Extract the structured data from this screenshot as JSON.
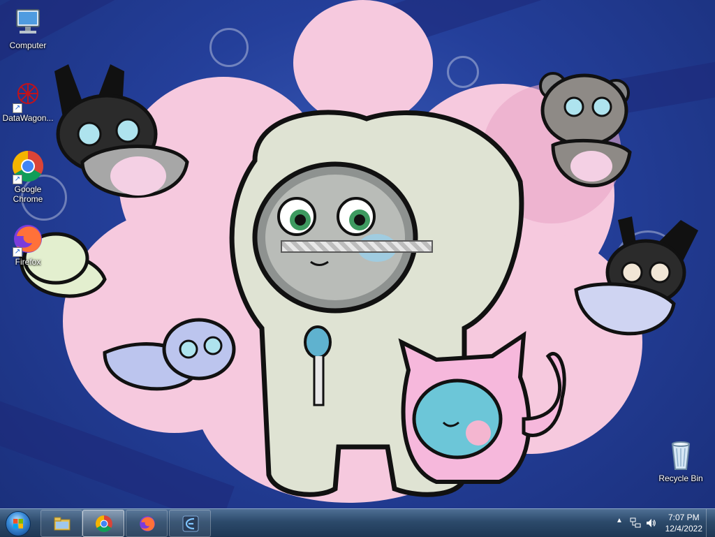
{
  "desktop": {
    "icons": [
      {
        "label": "Computer"
      },
      {
        "label": "DataWagon..."
      },
      {
        "label": "Google Chrome"
      },
      {
        "label": "Firefox"
      },
      {
        "label": "Recycle Bin"
      }
    ]
  },
  "progress": {
    "value": 1.0
  },
  "taskbar": {
    "pinned": [
      {
        "icon": "file-explorer-icon"
      },
      {
        "icon": "chrome-icon"
      },
      {
        "icon": "firefox-icon"
      },
      {
        "icon": "app-icon"
      }
    ],
    "clock": {
      "time": "7:07 PM",
      "date": "12/4/2022"
    }
  },
  "colors": {
    "accent": "#3b8edb",
    "taskbar": "#2c4a6b"
  }
}
